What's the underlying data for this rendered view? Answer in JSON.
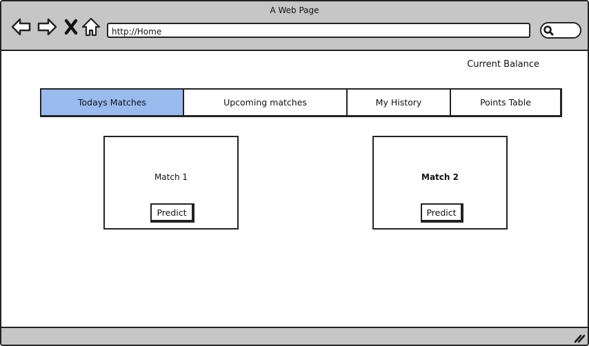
{
  "window": {
    "title": "A Web Page"
  },
  "address_bar": {
    "url": "http://Home"
  },
  "icons": {
    "back": "arrow-left-icon",
    "forward": "arrow-right-icon",
    "stop": "close-icon",
    "home": "home-icon",
    "search": "search-icon",
    "resize": "resize-grip-icon"
  },
  "header": {
    "balance_label": "Current Balance"
  },
  "tabs": [
    {
      "label": "Todays Matches",
      "active": true
    },
    {
      "label": "Upcoming matches",
      "active": false
    },
    {
      "label": "My History",
      "active": false
    },
    {
      "label": "Points Table",
      "active": false
    }
  ],
  "matches": [
    {
      "title": "Match 1",
      "button_label": "Predict"
    },
    {
      "title": "Match 2",
      "button_label": "Predict"
    }
  ],
  "colors": {
    "chrome": "#c6c6c6",
    "active_tab": "#99bbee",
    "border": "#222222"
  }
}
